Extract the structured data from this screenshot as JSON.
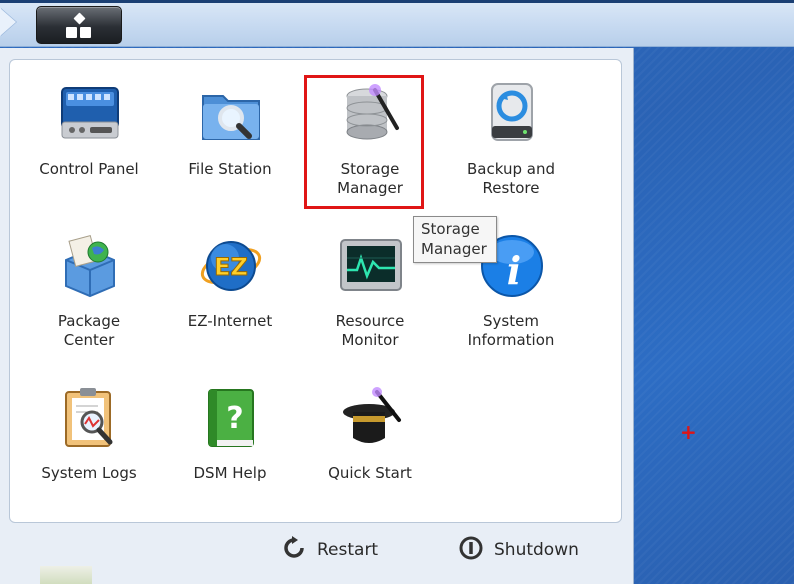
{
  "apps": [
    {
      "id": "control-panel",
      "label": "Control Panel",
      "icon": "control-panel-icon"
    },
    {
      "id": "file-station",
      "label": "File Station",
      "icon": "folder-search-icon"
    },
    {
      "id": "storage-manager",
      "label": "Storage\nManager",
      "icon": "database-wand-icon"
    },
    {
      "id": "backup-restore",
      "label": "Backup and\nRestore",
      "icon": "drive-refresh-icon"
    },
    {
      "id": "package-center",
      "label": "Package\nCenter",
      "icon": "package-box-icon"
    },
    {
      "id": "ez-internet",
      "label": "EZ-Internet",
      "icon": "ez-globe-icon"
    },
    {
      "id": "resource-monitor",
      "label": "Resource\nMonitor",
      "icon": "monitor-graph-icon"
    },
    {
      "id": "system-information",
      "label": "System\nInformation",
      "icon": "info-icon"
    },
    {
      "id": "system-logs",
      "label": "System Logs",
      "icon": "clipboard-magnifier-icon"
    },
    {
      "id": "dsm-help",
      "label": "DSM Help",
      "icon": "help-book-icon"
    },
    {
      "id": "quick-start",
      "label": "Quick Start",
      "icon": "magic-hat-icon"
    }
  ],
  "tooltip": {
    "text": "Storage\nManager"
  },
  "footer": {
    "restart_label": "Restart",
    "shutdown_label": "Shutdown"
  },
  "colors": {
    "highlight": "#e01515",
    "desktop": "#2a64b8",
    "panel": "#ffffff"
  }
}
